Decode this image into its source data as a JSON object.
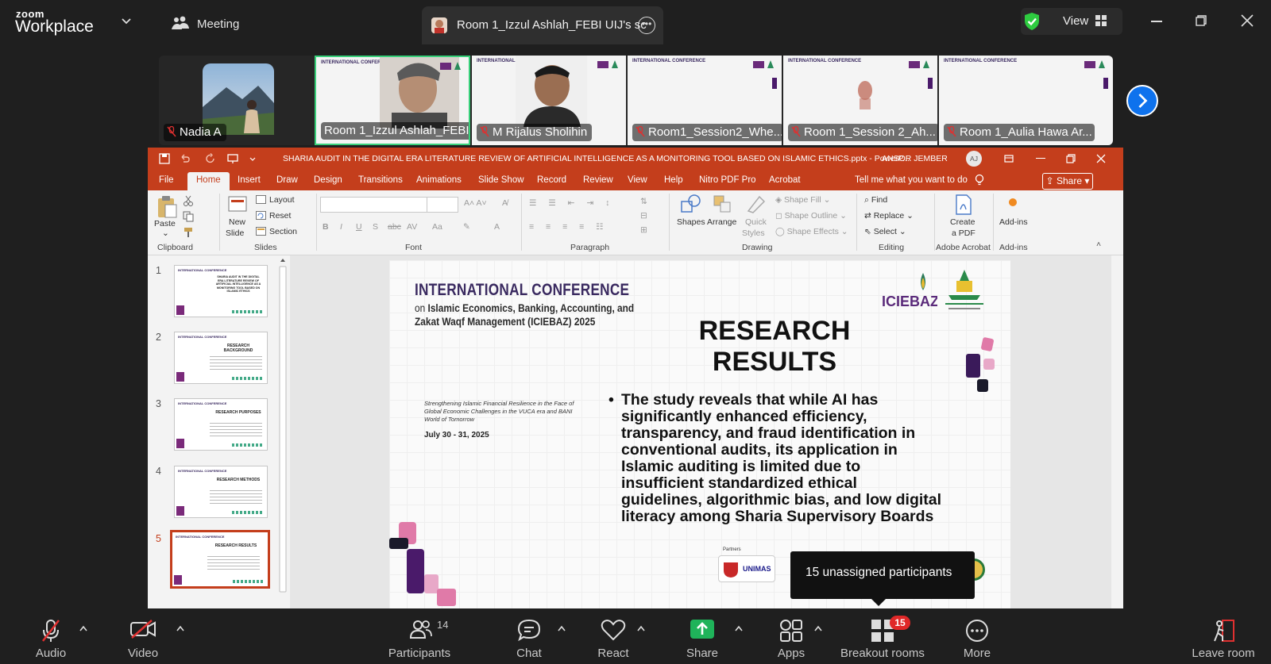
{
  "topbar": {
    "brand_small": "zoom",
    "brand_big": "Workplace",
    "meeting_label": "Meeting",
    "tab_label": "Room 1_Izzul Ashlah_FEBI UIJ's sc",
    "view_label": "View",
    "colors": {
      "shield": "#2ecc40",
      "tab_bg": "#2f2f2f"
    }
  },
  "gallery": {
    "tiles": [
      {
        "name": "Nadia A",
        "muted": true
      },
      {
        "name": "Room 1_Izzul Ashlah_FEBI...",
        "muted": false,
        "active": true
      },
      {
        "name": "M Rijalus Sholihin",
        "muted": true
      },
      {
        "name": "Room1_Session2_Whe...",
        "muted": true
      },
      {
        "name": "Room 1_Session 2_Ah...",
        "muted": true
      },
      {
        "name": "Room 1_Aulia Hawa Ar...",
        "muted": true
      }
    ],
    "mini_conf_title": "INTERNATIONAL CONFERENCE",
    "mini_conf_sub": "on Islamic Economics, Banking, Accounting, and Zakat Waqf Management (ICIEBAZ) 2025"
  },
  "powerpoint": {
    "file_title": "SHARIA AUDIT IN THE DIGITAL ERA LITERATURE REVIEW OF ARTIFICIAL INTELLIGENCE AS A MONITORING TOOL BASED ON ISLAMIC ETHICS.pptx - PowerP...",
    "user": "ANSOR JEMBER",
    "user_initials": "AJ",
    "tabs": [
      "File",
      "Home",
      "Insert",
      "Draw",
      "Design",
      "Transitions",
      "Animations",
      "Slide Show",
      "Record",
      "Review",
      "View",
      "Help",
      "Nitro PDF Pro",
      "Acrobat"
    ],
    "tell_me": "Tell me what you want to do",
    "share": "Share",
    "ribbon": {
      "paste": "Paste",
      "new_slide": "New",
      "new_slide2": "Slide",
      "layout": "Layout",
      "reset": "Reset",
      "section": "Section",
      "shapes": "Shapes",
      "arrange": "Arrange",
      "quick": "Quick",
      "styles": "Styles",
      "shape_fill": "Shape Fill",
      "shape_outline": "Shape Outline",
      "shape_effects": "Shape Effects",
      "find": "Find",
      "replace": "Replace",
      "select": "Select",
      "create": "Create",
      "apdf": "a PDF",
      "addins": "Add-ins",
      "groups": [
        "Clipboard",
        "Slides",
        "Font",
        "Paragraph",
        "Drawing",
        "Editing",
        "Adobe Acrobat",
        "Add-ins"
      ]
    },
    "thumbnails": [
      {
        "num": "1",
        "title": "SHARIA AUDIT IN THE DIGITAL ERA LITERATURE REVIEW OF ARTIFICIAL INTELLIGENCE AS A MONITORING TOOL BASED ON ISLAMIC ETHICS"
      },
      {
        "num": "2",
        "title": "RESEARCH BACKGROUND"
      },
      {
        "num": "3",
        "title": "RESEARCH PURPOSES"
      },
      {
        "num": "4",
        "title": "RESEARCH METHODS"
      },
      {
        "num": "5",
        "title": "RESEARCH RESULTS",
        "selected": true
      }
    ],
    "slide": {
      "conf_title": "INTERNATIONAL CONFERENCE",
      "conf_line2_prefix": "on ",
      "conf_line2": "Islamic Economics, Banking, Accounting, and",
      "conf_line3": "Zakat Waqf Management (ICIEBAZ) 2025",
      "subtitle": "Strengthening Islamic Financial Resilience in the Face of Global Economic Challenges in the VUCA era and BANI World of Tomorrow",
      "date": "July 30 - 31, 2025",
      "heading": "RESEARCH RESULTS",
      "bullet": "The study reveals that while AI has significantly enhanced efficiency, transparency, and fraud identification in conventional audits, its application in Islamic auditing is limited due to insufficient standardized ethical guidelines, algorithmic bias, and low digital literacy among Sharia Supervisory Boards",
      "logo_text": "ICIEBAZ",
      "partners": "Partners",
      "unimas": "UNIMAS"
    },
    "colors": {
      "accent": "#c43e1c",
      "slide_title": "#3a2a60"
    }
  },
  "tooltip": "15 unassigned participants",
  "toolbar": {
    "audio": "Audio",
    "video": "Video",
    "participants": "Participants",
    "participants_count": "14",
    "chat": "Chat",
    "react": "React",
    "share": "Share",
    "apps": "Apps",
    "breakout": "Breakout rooms",
    "breakout_badge": "15",
    "more": "More",
    "leave": "Leave room",
    "colors": {
      "share_green": "#1fb35a",
      "badge_red": "#e02828"
    }
  }
}
